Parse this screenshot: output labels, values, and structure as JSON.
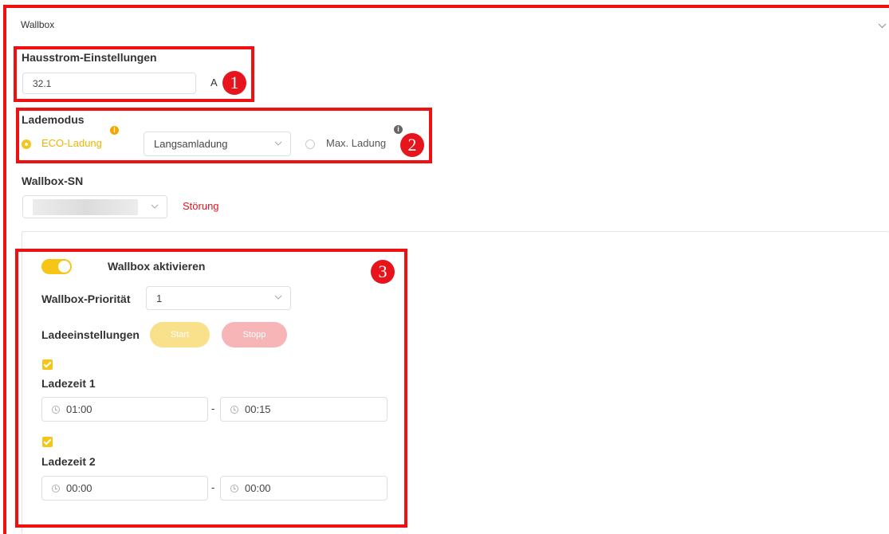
{
  "panel": {
    "title": "Wallbox"
  },
  "hausstrom": {
    "label": "Hausstrom-Einstellungen",
    "value": "32.1",
    "unit": "A"
  },
  "lademodus": {
    "label": "Lademodus",
    "eco_label": "ECO-Ladung",
    "eco_select": "Langsamladung",
    "max_label": "Max. Ladung",
    "selected": "eco"
  },
  "wallbox_sn": {
    "label": "Wallbox-SN",
    "status": "Störung"
  },
  "card": {
    "activate_label": "Wallbox aktivieren",
    "activate_on": true,
    "priority_label": "Wallbox-Priorität",
    "priority_value": "1",
    "ladeeinstellungen_label": "Ladeeinstellungen",
    "start_label": "Start",
    "stopp_label": "Stopp",
    "slots": [
      {
        "label": "Ladezeit 1",
        "checked": true,
        "from": "01:00",
        "to": "00:15",
        "dash": "-"
      },
      {
        "label": "Ladezeit 2",
        "checked": true,
        "from": "00:00",
        "to": "00:00",
        "dash": "-"
      }
    ]
  },
  "markers": [
    "1",
    "2",
    "3"
  ],
  "colors": {
    "accent": "#f5c518",
    "error": "#e8141d",
    "annotation": "#ee1111"
  }
}
